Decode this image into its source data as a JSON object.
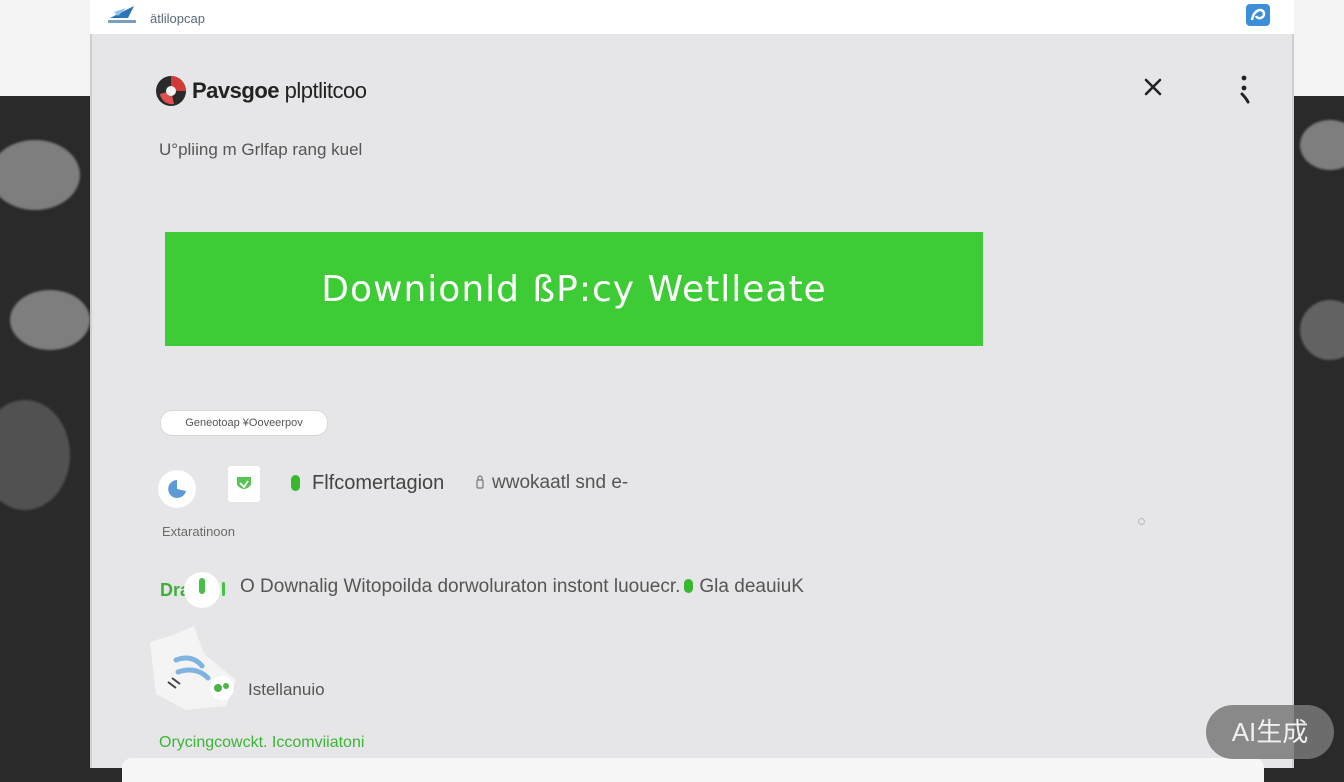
{
  "topbar": {
    "app_name": "ätlilopcap",
    "app_icon": "plane-icon",
    "corner_icon": "shield-logo-icon"
  },
  "header": {
    "brand_bold": "Pavsgoe",
    "brand_rest": " plptlitcoo",
    "brand_logo": "globe-logo-icon",
    "close_icon": "close-icon",
    "more_icon": "more-vertical-icon"
  },
  "subtitle": "U°pliing m Grlfap rang kuel",
  "download_button": {
    "label": "Downionld ßP:cy  Wetlleate",
    "color": "#3dcc36"
  },
  "pill_label": "Geneotoap ¥Ooveerpov",
  "features": {
    "item_a": "Flfcomertagion",
    "item_b": "wwokaatl snd e-",
    "caption": "Extaratinoon"
  },
  "info_line": {
    "badge_text": "Dra",
    "text_a": "O Downalig  Witopoilda  dorwoluraton  instont luouecr.",
    "text_b": "Gla   deauiuK"
  },
  "install_label": "Istellanuio",
  "footer_link": "Orycingcowckt. Iccomviiatoni",
  "watermark": "AI生成",
  "colors": {
    "accent_green": "#3dcc36",
    "panel_bg": "#e6e6e8"
  }
}
